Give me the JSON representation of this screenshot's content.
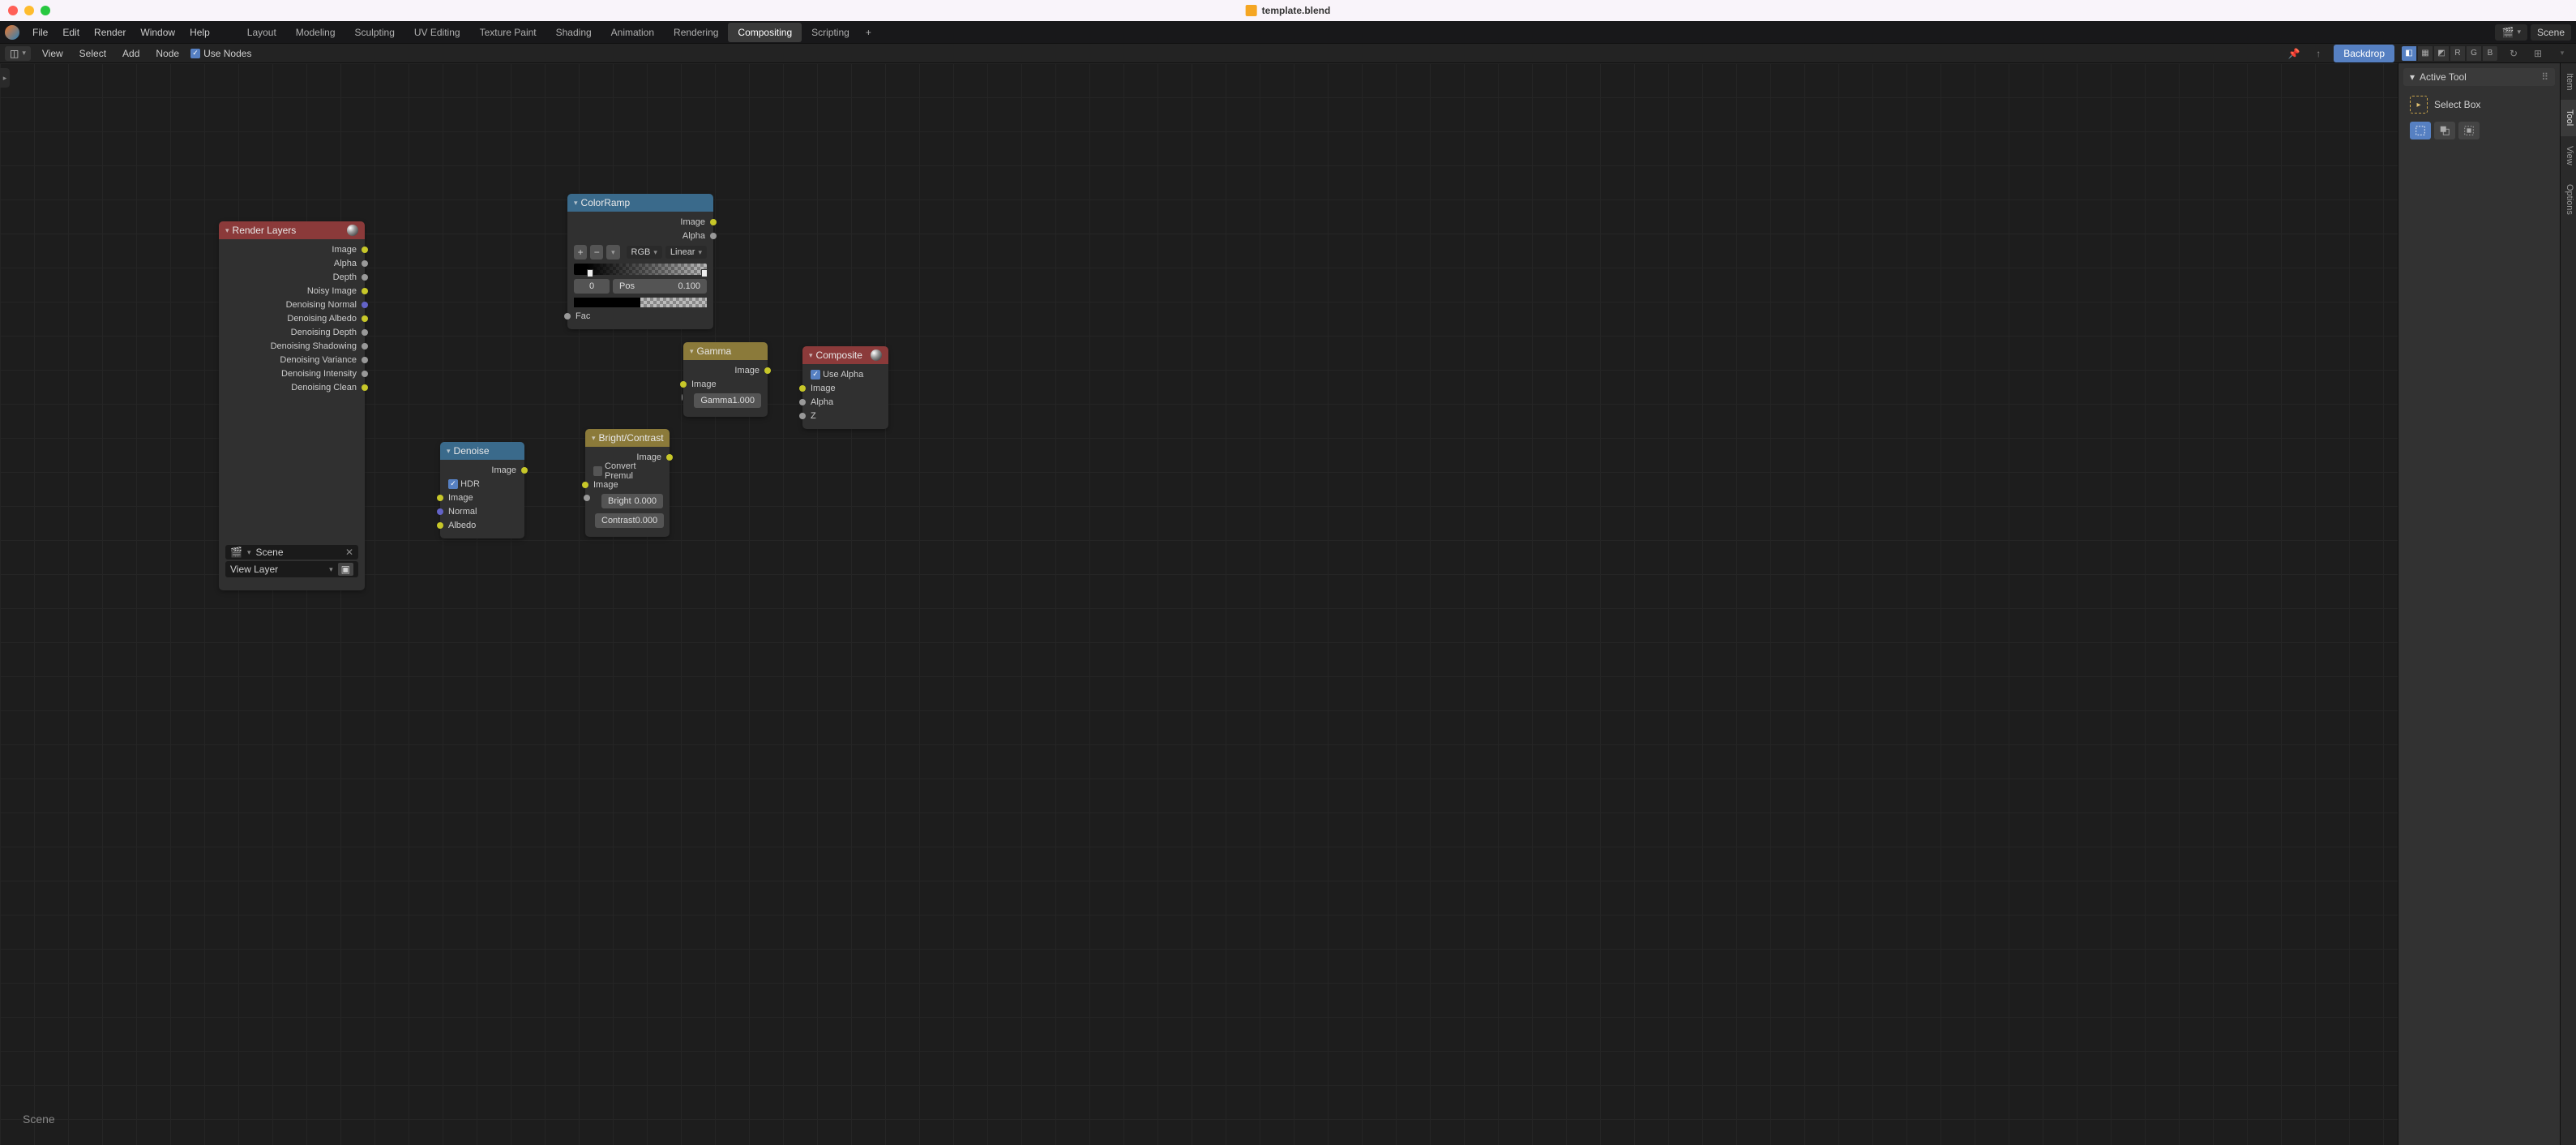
{
  "window": {
    "filename": "template.blend"
  },
  "main_menu": [
    "File",
    "Edit",
    "Render",
    "Window",
    "Help"
  ],
  "tabs": [
    "Layout",
    "Modeling",
    "Sculpting",
    "UV Editing",
    "Texture Paint",
    "Shading",
    "Animation",
    "Rendering",
    "Compositing",
    "Scripting"
  ],
  "active_tab": "Compositing",
  "scene_selector": {
    "label": "Scene"
  },
  "editor_header": {
    "menus": [
      "View",
      "Select",
      "Add",
      "Node"
    ],
    "use_nodes_label": "Use Nodes",
    "use_nodes": true,
    "backdrop_label": "Backdrop",
    "channel_buttons": [
      "R",
      "G",
      "B"
    ]
  },
  "breadcrumb": "Scene",
  "sidebar": {
    "panel_title": "Active Tool",
    "tool_name": "Select Box",
    "tabs": [
      "Item",
      "Tool",
      "View",
      "Options"
    ],
    "active_tab": "Tool"
  },
  "nodes": {
    "render_layers": {
      "title": "Render Layers",
      "outputs": [
        "Image",
        "Alpha",
        "Depth",
        "Noisy Image",
        "Denoising Normal",
        "Denoising Albedo",
        "Denoising Depth",
        "Denoising Shadowing",
        "Denoising Variance",
        "Denoising Intensity",
        "Denoising Clean"
      ],
      "scene": "Scene",
      "layer": "View Layer"
    },
    "color_ramp": {
      "title": "ColorRamp",
      "out_image": "Image",
      "out_alpha": "Alpha",
      "mode": "RGB",
      "interp": "Linear",
      "stop_index": "0",
      "pos_label": "Pos",
      "pos_value": "0.100",
      "in_fac": "Fac"
    },
    "gamma": {
      "title": "Gamma",
      "out_image": "Image",
      "in_image": "Image",
      "gamma_label": "Gamma",
      "gamma_value": "1.000"
    },
    "composite": {
      "title": "Composite",
      "use_alpha_label": "Use Alpha",
      "use_alpha": true,
      "in_image": "Image",
      "in_alpha": "Alpha",
      "in_z": "Z"
    },
    "denoise": {
      "title": "Denoise",
      "out_image": "Image",
      "hdr_label": "HDR",
      "hdr": true,
      "in_image": "Image",
      "in_normal": "Normal",
      "in_albedo": "Albedo"
    },
    "bright_contrast": {
      "title": "Bright/Contrast",
      "out_image": "Image",
      "convert_label": "Convert Premul",
      "convert": false,
      "in_image": "Image",
      "bright_label": "Bright",
      "bright_value": "0.000",
      "contrast_label": "Contrast",
      "contrast_value": "0.000"
    }
  }
}
